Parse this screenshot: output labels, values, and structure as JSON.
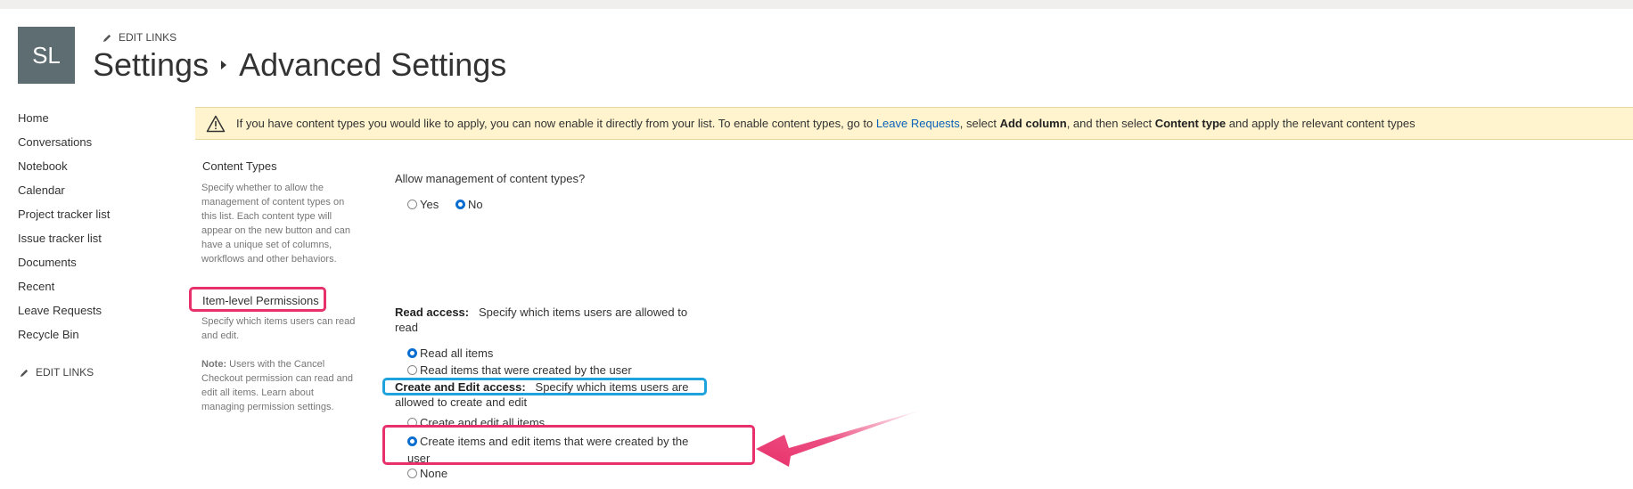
{
  "header": {
    "logo_initials": "SL",
    "edit_links": "EDIT LINKS",
    "breadcrumb": [
      "Settings",
      "Advanced Settings"
    ]
  },
  "leftnav": {
    "items": [
      "Home",
      "Conversations",
      "Notebook",
      "Calendar",
      "Project tracker list",
      "Issue tracker list",
      "Documents",
      "Recent",
      "Leave Requests",
      "Recycle Bin"
    ],
    "edit_links": "EDIT LINKS"
  },
  "notice": {
    "text1": "If you have content types you would like to apply, you can now enable it directly from your list. To enable content types, go to ",
    "link": "Leave Requests",
    "text2": ", select ",
    "bold1": "Add column",
    "text3": ", and then select ",
    "bold2": "Content type",
    "text4": " and apply the relevant content types",
    "icon": "warning-icon"
  },
  "content_types": {
    "title": "Content Types",
    "description": "Specify whether to allow the management of content types on this list. Each content type will appear on the new button and can have a unique set of columns, workflows and other behaviors.",
    "question": "Allow management of content types?",
    "options": [
      "Yes",
      "No"
    ],
    "selected": "No"
  },
  "item_permissions": {
    "title": "Item-level Permissions",
    "description": "Specify which items users can read and edit.",
    "note_label": "Note:",
    "note_text": " Users with the Cancel Checkout permission can read and edit all items. Learn about managing permission settings.",
    "read_label": "Read access:",
    "read_desc": "Specify which items users are allowed to read",
    "read_options": [
      "Read all items",
      "Read items that were created by the user"
    ],
    "read_selected": "Read all items",
    "edit_label": "Create and Edit access:",
    "edit_desc": "Specify which items users are allowed to create and edit",
    "edit_options": [
      "Create and edit all items",
      "Create items and edit items that were created by the user",
      "None"
    ],
    "edit_selected": "Create items and edit items that were created by the user"
  },
  "colors": {
    "highlight_pink": "#e8306b",
    "highlight_blue": "#1fa3dd",
    "radio_selected": "#0a6ed1",
    "notice_bg": "#fff4ce",
    "link": "#0b62b9"
  }
}
